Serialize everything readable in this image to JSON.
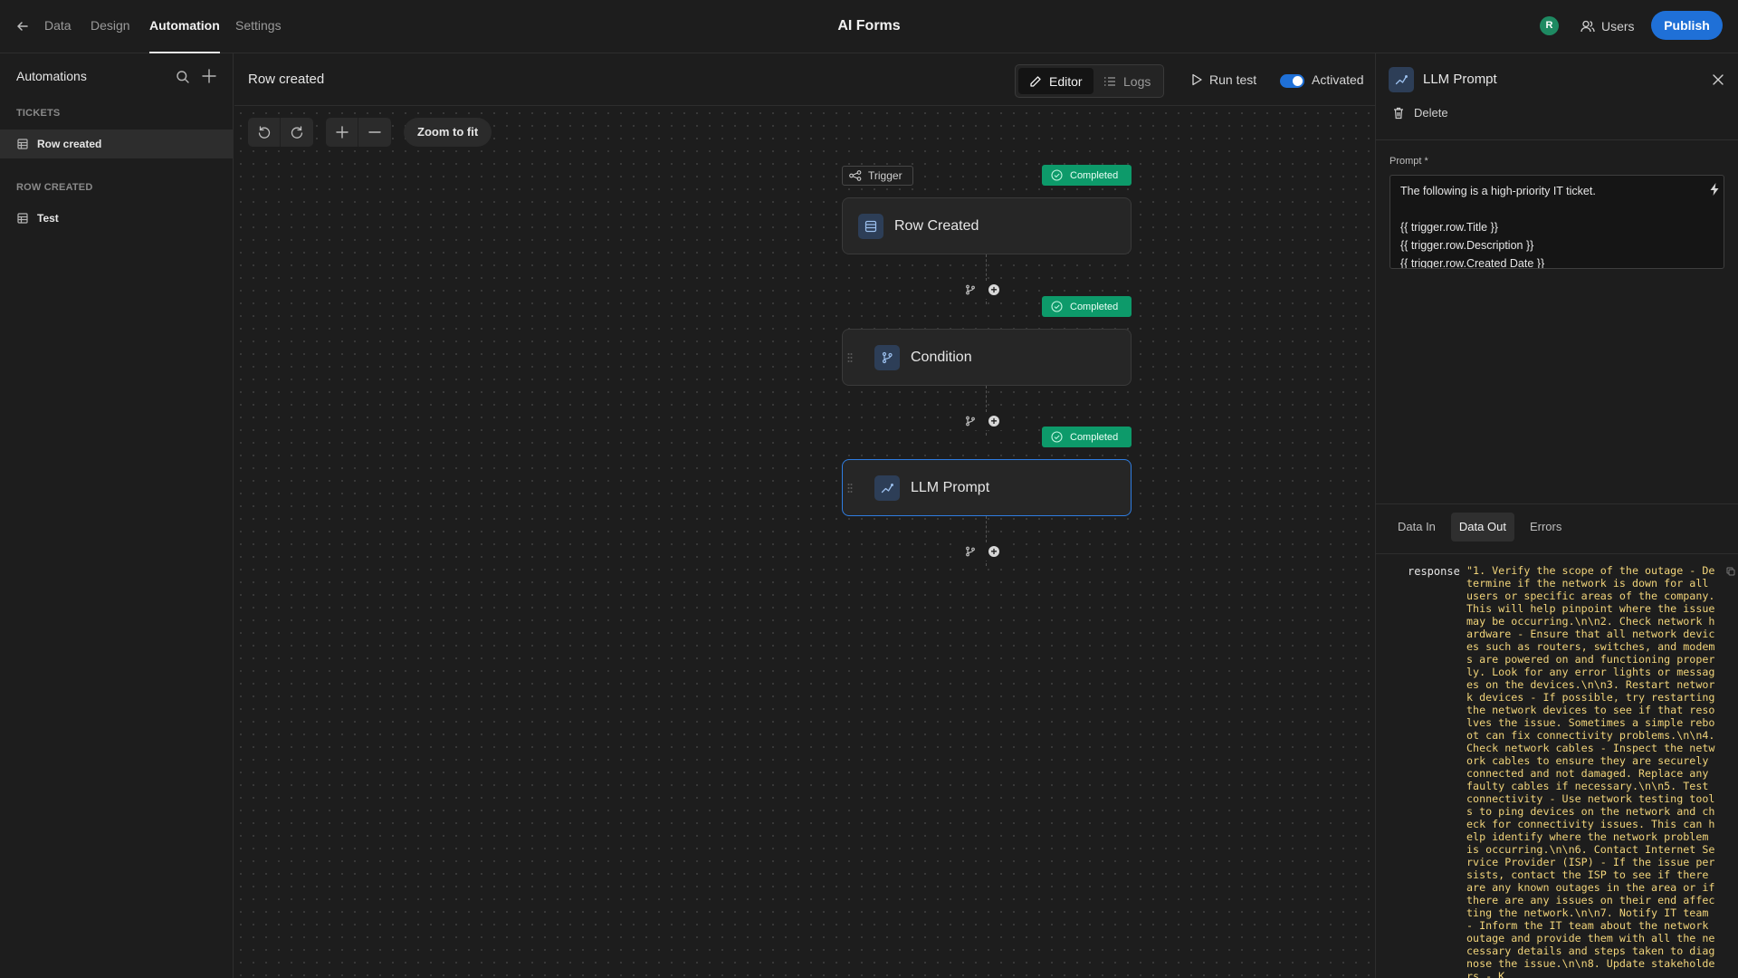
{
  "topbar": {
    "tabs": [
      "Data",
      "Design",
      "Automation",
      "Settings"
    ],
    "active_tab": "Automation",
    "app_title": "AI Forms",
    "avatar_initial": "R",
    "users_label": "Users",
    "publish_label": "Publish"
  },
  "sidebar": {
    "title": "Automations",
    "sections": [
      {
        "heading": "TICKETS",
        "items": [
          {
            "label": "Row created",
            "active": true
          }
        ]
      },
      {
        "heading": "ROW CREATED",
        "items": [
          {
            "label": "Test",
            "active": false
          }
        ]
      }
    ]
  },
  "canvas_header": {
    "title": "Row created",
    "editor_label": "Editor",
    "logs_label": "Logs",
    "run_test_label": "Run test",
    "activated_label": "Activated",
    "activated": true
  },
  "toolbar": {
    "zoom_fit_label": "Zoom to fit"
  },
  "flow": {
    "trigger_label": "Trigger",
    "status_label": "Completed",
    "nodes": [
      {
        "label": "Row Created",
        "icon": "table-icon"
      },
      {
        "label": "Condition",
        "icon": "branch-icon"
      },
      {
        "label": "LLM Prompt",
        "icon": "chart-line-icon",
        "selected": true
      }
    ]
  },
  "panel": {
    "title": "LLM Prompt",
    "delete_label": "Delete",
    "prompt_label": "Prompt *",
    "prompt_value": "The following is a high-priority IT ticket.\n\n{{ trigger.row.Title }}\n{{ trigger.row.Description }}\n{{ trigger.row.Created Date }}",
    "tabs": [
      "Data In",
      "Data Out",
      "Errors"
    ],
    "active_tab": "Data Out",
    "response_key": "response",
    "response_value": "\"1. Verify the scope of the outage - Determine if the network is down for all users or specific areas of the company. This will help pinpoint where the issue may be occurring.\\n\\n2. Check network hardware - Ensure that all network devices such as routers, switches, and modems are powered on and functioning properly. Look for any error lights or messages on the devices.\\n\\n3. Restart network devices - If possible, try restarting the network devices to see if that resolves the issue. Sometimes a simple reboot can fix connectivity problems.\\n\\n4. Check network cables - Inspect the network cables to ensure they are securely connected and not damaged. Replace any faulty cables if necessary.\\n\\n5. Test connectivity - Use network testing tools to ping devices on the network and check for connectivity issues. This can help identify where the network problem is occurring.\\n\\n6. Contact Internet Service Provider (ISP) - If the issue persists, contact the ISP to see if there are any known outages in the area or if there are any issues on their end affecting the network.\\n\\n7. Notify IT team - Inform the IT team about the network outage and provide them with all the necessary details and steps taken to diagnose the issue.\\n\\n8. Update stakeholders - K"
  },
  "colors": {
    "accent": "#1f70d7",
    "completed": "#0d9a6a",
    "response_text": "#f1d47a"
  }
}
